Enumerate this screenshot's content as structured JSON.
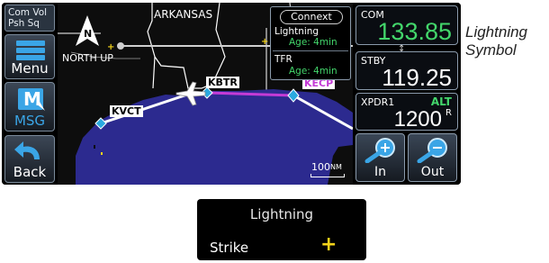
{
  "left_panel": {
    "com_vol_line1": "Com Vol",
    "com_vol_line2": "Psh Sq",
    "menu_label": "Menu",
    "msg_label": "MSG",
    "back_label": "Back"
  },
  "map": {
    "region_label": "ARKANSAS",
    "orientation": "NORTH UP",
    "airports": [
      "KBTR",
      "KVCT",
      "KECP"
    ],
    "scale": "100",
    "scale_unit": "NM",
    "overlay": {
      "title": "Connext",
      "item1_name": "Lightning",
      "item1_age": "Age: 4min",
      "item2_name": "TFR",
      "item2_age": "Age: 4min"
    }
  },
  "right_panel": {
    "com_label": "COM",
    "com_freq": "133.85",
    "stby_label": "STBY",
    "stby_freq": "119.25",
    "xpdr_label": "XPDR1",
    "xpdr_mode": "ALT",
    "xpdr_code": "1200",
    "xpdr_suffix": "R",
    "zoom_in_label": "In",
    "zoom_out_label": "Out"
  },
  "callout": {
    "line1": "Lightning",
    "line2": "Symbol"
  },
  "legend": {
    "title": "Lightning",
    "strike_label": "Strike",
    "strike_symbol": "+"
  },
  "colors": {
    "water": "#2c2a8f",
    "land": "#111111",
    "flight_path": "#ffffff",
    "active_leg": "#c43bd6",
    "waypoint": "#2aa9e0",
    "lightning": "#f2d21a",
    "freq_green": "#43d66b"
  }
}
